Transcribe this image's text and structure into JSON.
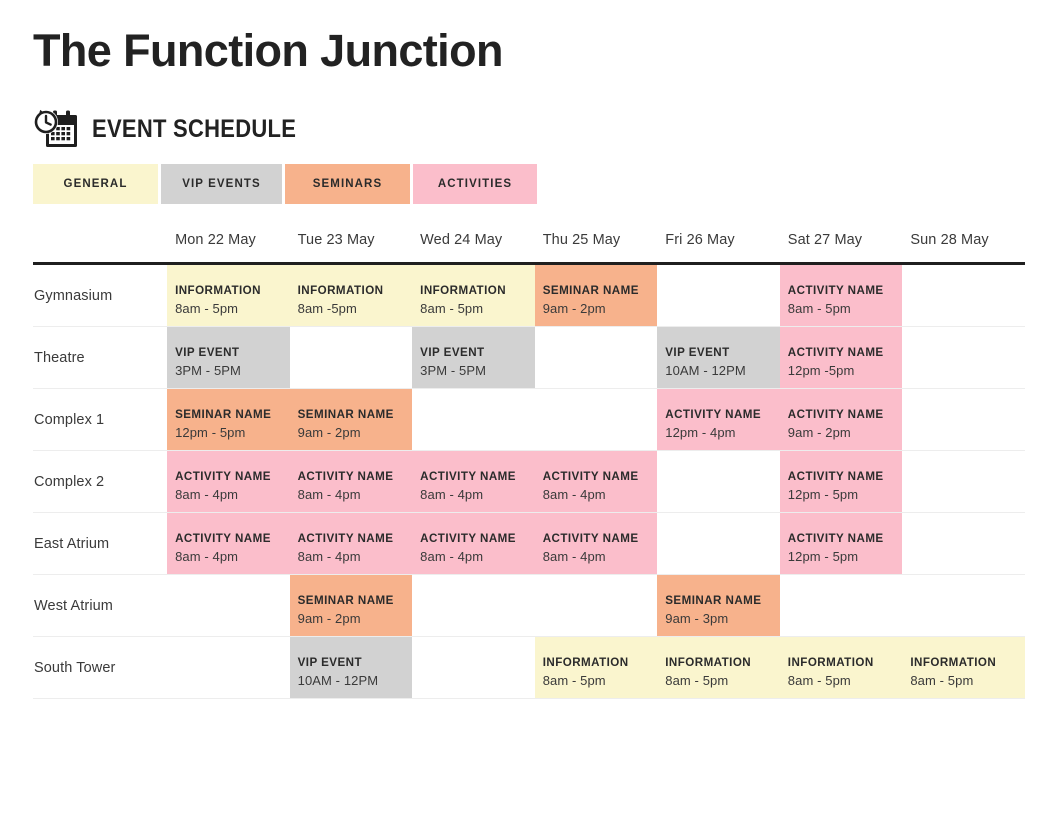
{
  "header": {
    "title": "The Function Junction",
    "subtitle": "EVENT SCHEDULE",
    "icon": "calendar-clock-icon"
  },
  "legend": {
    "tabs": [
      {
        "label": "GENERAL",
        "color": "#FAF5CE",
        "key": "general"
      },
      {
        "label": "VIP EVENTS",
        "color": "#D2D2D2",
        "key": "vip"
      },
      {
        "label": "SEMINARS",
        "color": "#F7B28C",
        "key": "seminar"
      },
      {
        "label": "ACTIVITIES",
        "color": "#FBBECB",
        "key": "activity"
      }
    ]
  },
  "colors": {
    "general": "#FAF5CE",
    "vip": "#D2D2D2",
    "seminar": "#F7B28C",
    "activity": "#FBBECB",
    "empty": "transparent",
    "rule": "#1f1f1f",
    "grid": "#ededed",
    "text": "#2b2b2b",
    "background": "#FFFFFF"
  },
  "schedule": {
    "row_label_header": "",
    "days": [
      "Mon 22 May",
      "Tue 23 May",
      "Wed 24 May",
      "Thu 25 May",
      "Fri 26 May",
      "Sat 27 May",
      "Sun 28 May"
    ],
    "rows": [
      {
        "venue": "Gymnasium",
        "cells": [
          {
            "name": "INFORMATION",
            "time": "8am - 5pm",
            "type": "general"
          },
          {
            "name": "INFORMATION",
            "time": "8am -5pm",
            "type": "general"
          },
          {
            "name": "INFORMATION",
            "time": "8am - 5pm",
            "type": "general"
          },
          {
            "name": "SEMINAR NAME",
            "time": "9am - 2pm",
            "type": "seminar"
          },
          {
            "name": "",
            "time": "",
            "type": "empty"
          },
          {
            "name": "ACTIVITY NAME",
            "time": "8am - 5pm",
            "type": "activity"
          },
          {
            "name": "",
            "time": "",
            "type": "empty"
          }
        ]
      },
      {
        "venue": "Theatre",
        "cells": [
          {
            "name": "VIP EVENT",
            "time": "3PM - 5PM",
            "type": "vip"
          },
          {
            "name": "",
            "time": "",
            "type": "empty"
          },
          {
            "name": "VIP EVENT",
            "time": "3PM - 5PM",
            "type": "vip"
          },
          {
            "name": "",
            "time": "",
            "type": "empty"
          },
          {
            "name": "VIP EVENT",
            "time": "10AM - 12PM",
            "type": "vip"
          },
          {
            "name": "ACTIVITY NAME",
            "time": "12pm -5pm",
            "type": "activity"
          },
          {
            "name": "",
            "time": "",
            "type": "empty"
          }
        ]
      },
      {
        "venue": "Complex 1",
        "cells": [
          {
            "name": "SEMINAR NAME",
            "time": "12pm - 5pm",
            "type": "seminar"
          },
          {
            "name": "SEMINAR NAME",
            "time": "9am - 2pm",
            "type": "seminar"
          },
          {
            "name": "",
            "time": "",
            "type": "empty"
          },
          {
            "name": "",
            "time": "",
            "type": "empty"
          },
          {
            "name": "ACTIVITY NAME",
            "time": "12pm - 4pm",
            "type": "activity"
          },
          {
            "name": "ACTIVITY NAME",
            "time": "9am - 2pm",
            "type": "activity"
          },
          {
            "name": "",
            "time": "",
            "type": "empty"
          }
        ]
      },
      {
        "venue": "Complex 2",
        "cells": [
          {
            "name": "ACTIVITY NAME",
            "time": "8am - 4pm",
            "type": "activity"
          },
          {
            "name": "ACTIVITY NAME",
            "time": "8am - 4pm",
            "type": "activity"
          },
          {
            "name": "ACTIVITY NAME",
            "time": "8am - 4pm",
            "type": "activity"
          },
          {
            "name": "ACTIVITY NAME",
            "time": "8am - 4pm",
            "type": "activity"
          },
          {
            "name": "",
            "time": "",
            "type": "empty"
          },
          {
            "name": "ACTIVITY NAME",
            "time": "12pm - 5pm",
            "type": "activity"
          },
          {
            "name": "",
            "time": "",
            "type": "empty"
          }
        ]
      },
      {
        "venue": "East Atrium",
        "cells": [
          {
            "name": "ACTIVITY NAME",
            "time": "8am - 4pm",
            "type": "activity"
          },
          {
            "name": "ACTIVITY NAME",
            "time": "8am - 4pm",
            "type": "activity"
          },
          {
            "name": "ACTIVITY NAME",
            "time": "8am - 4pm",
            "type": "activity"
          },
          {
            "name": "ACTIVITY NAME",
            "time": "8am - 4pm",
            "type": "activity"
          },
          {
            "name": "",
            "time": "",
            "type": "empty"
          },
          {
            "name": "ACTIVITY NAME",
            "time": "12pm - 5pm",
            "type": "activity"
          },
          {
            "name": "",
            "time": "",
            "type": "empty"
          }
        ]
      },
      {
        "venue": "West Atrium",
        "cells": [
          {
            "name": "",
            "time": "",
            "type": "empty"
          },
          {
            "name": "SEMINAR NAME",
            "time": "9am - 2pm",
            "type": "seminar"
          },
          {
            "name": "",
            "time": "",
            "type": "empty"
          },
          {
            "name": "",
            "time": "",
            "type": "empty"
          },
          {
            "name": "SEMINAR NAME",
            "time": "9am - 3pm",
            "type": "seminar"
          },
          {
            "name": "",
            "time": "",
            "type": "empty"
          },
          {
            "name": "",
            "time": "",
            "type": "empty"
          }
        ]
      },
      {
        "venue": "South Tower",
        "cells": [
          {
            "name": "",
            "time": "",
            "type": "empty"
          },
          {
            "name": "VIP EVENT",
            "time": "10AM - 12PM",
            "type": "vip"
          },
          {
            "name": "",
            "time": "",
            "type": "empty"
          },
          {
            "name": "INFORMATION",
            "time": "8am - 5pm",
            "type": "general"
          },
          {
            "name": "INFORMATION",
            "time": "8am - 5pm",
            "type": "general"
          },
          {
            "name": "INFORMATION",
            "time": "8am - 5pm",
            "type": "general"
          },
          {
            "name": "INFORMATION",
            "time": "8am - 5pm",
            "type": "general"
          }
        ]
      }
    ]
  }
}
